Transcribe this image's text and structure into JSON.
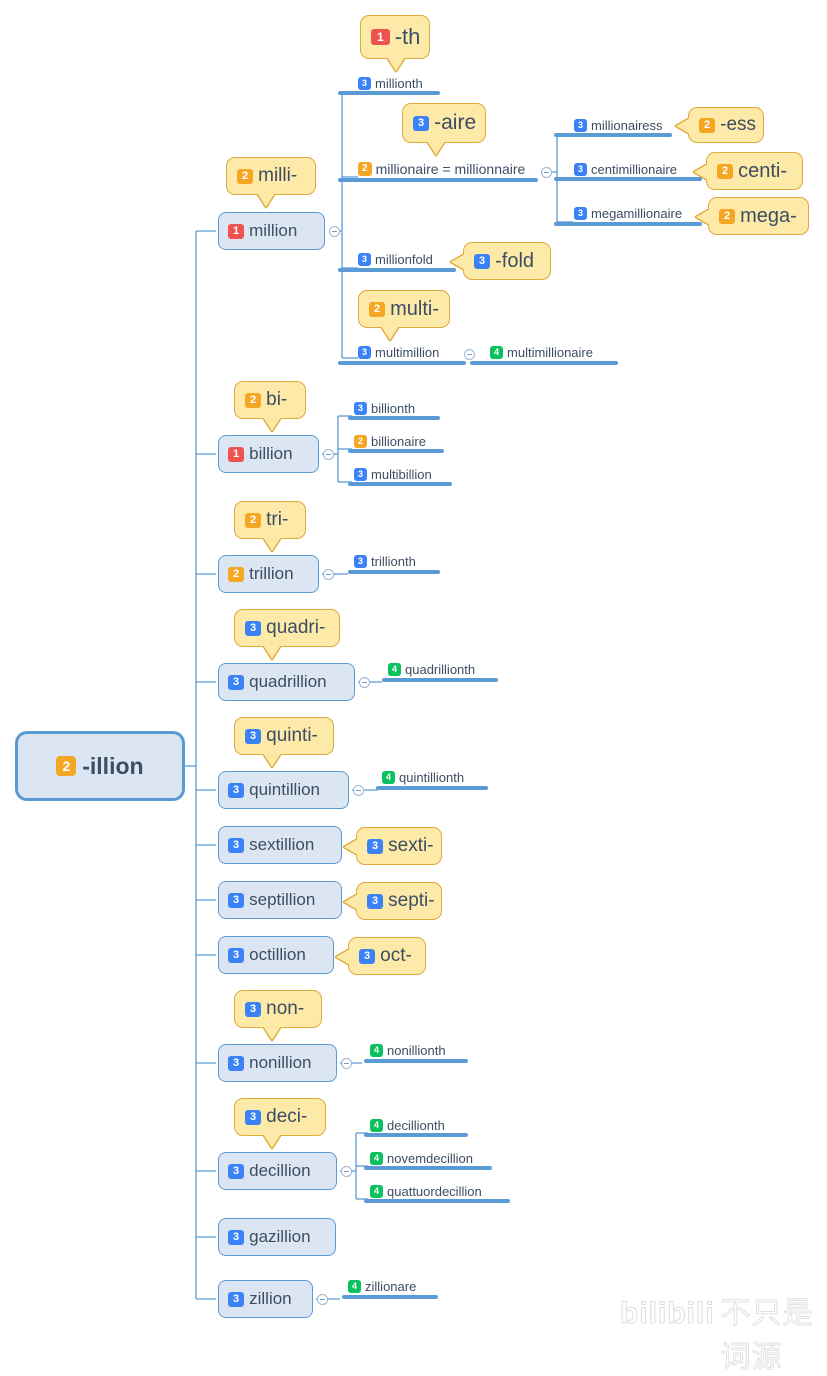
{
  "root": {
    "badge": "2",
    "level": 2,
    "label": "-illion"
  },
  "branches": [
    {
      "id": "million",
      "badge": "1",
      "level": 1,
      "label": "million",
      "prefix_callout": {
        "badge": "2",
        "level": 2,
        "label": "milli-"
      },
      "children": [
        {
          "badge": "3",
          "level": 3,
          "label": "millionth",
          "callout": {
            "badge": "1",
            "level": 1,
            "label": "-th",
            "dir": "down"
          }
        },
        {
          "badge": "2",
          "level": 2,
          "label": "millionaire = millionnaire",
          "callout": {
            "badge": "3",
            "level": 3,
            "label": "-aire",
            "dir": "down"
          },
          "children": [
            {
              "badge": "3",
              "level": 3,
              "label": "millionairess",
              "callout": {
                "badge": "2",
                "level": 2,
                "label": "-ess",
                "dir": "left"
              }
            },
            {
              "badge": "3",
              "level": 3,
              "label": "centimillionaire",
              "callout": {
                "badge": "2",
                "level": 2,
                "label": "centi-",
                "dir": "left"
              }
            },
            {
              "badge": "3",
              "level": 3,
              "label": "megamillionaire",
              "callout": {
                "badge": "2",
                "level": 2,
                "label": "mega-",
                "dir": "left"
              }
            }
          ]
        },
        {
          "badge": "3",
          "level": 3,
          "label": "millionfold",
          "callout": {
            "badge": "3",
            "level": 3,
            "label": "-fold",
            "dir": "left"
          }
        },
        {
          "badge": "3",
          "level": 3,
          "label": "multimillion",
          "callout": {
            "badge": "2",
            "level": 2,
            "label": "multi-",
            "dir": "down"
          },
          "children": [
            {
              "badge": "4",
              "level": 4,
              "label": "multimillionaire"
            }
          ]
        }
      ]
    },
    {
      "id": "billion",
      "badge": "1",
      "level": 1,
      "label": "billion",
      "prefix_callout": {
        "badge": "2",
        "level": 2,
        "label": "bi-"
      },
      "children": [
        {
          "badge": "3",
          "level": 3,
          "label": "billionth"
        },
        {
          "badge": "2",
          "level": 2,
          "label": "billionaire"
        },
        {
          "badge": "3",
          "level": 3,
          "label": "multibillion"
        }
      ]
    },
    {
      "id": "trillion",
      "badge": "2",
      "level": 2,
      "label": "trillion",
      "prefix_callout": {
        "badge": "2",
        "level": 2,
        "label": "tri-"
      },
      "children": [
        {
          "badge": "3",
          "level": 3,
          "label": "trillionth"
        }
      ]
    },
    {
      "id": "quadrillion",
      "badge": "3",
      "level": 3,
      "label": "quadrillion",
      "prefix_callout": {
        "badge": "3",
        "level": 3,
        "label": "quadri-"
      },
      "children": [
        {
          "badge": "4",
          "level": 4,
          "label": "quadrillionth"
        }
      ]
    },
    {
      "id": "quintillion",
      "badge": "3",
      "level": 3,
      "label": "quintillion",
      "prefix_callout": {
        "badge": "3",
        "level": 3,
        "label": "quinti-"
      },
      "children": [
        {
          "badge": "4",
          "level": 4,
          "label": "quintillionth"
        }
      ]
    },
    {
      "id": "sextillion",
      "badge": "3",
      "level": 3,
      "label": "sextillion",
      "side_callout": {
        "badge": "3",
        "level": 3,
        "label": "sexti-"
      },
      "children": []
    },
    {
      "id": "septillion",
      "badge": "3",
      "level": 3,
      "label": "septillion",
      "side_callout": {
        "badge": "3",
        "level": 3,
        "label": "septi-"
      },
      "children": []
    },
    {
      "id": "octillion",
      "badge": "3",
      "level": 3,
      "label": "octillion",
      "side_callout": {
        "badge": "3",
        "level": 3,
        "label": "oct-"
      },
      "children": []
    },
    {
      "id": "nonillion",
      "badge": "3",
      "level": 3,
      "label": "nonillion",
      "prefix_callout": {
        "badge": "3",
        "level": 3,
        "label": "non-"
      },
      "children": [
        {
          "badge": "4",
          "level": 4,
          "label": "nonillionth"
        }
      ]
    },
    {
      "id": "decillion",
      "badge": "3",
      "level": 3,
      "label": "decillion",
      "prefix_callout": {
        "badge": "3",
        "level": 3,
        "label": "deci-"
      },
      "children": [
        {
          "badge": "4",
          "level": 4,
          "label": "decillionth"
        },
        {
          "badge": "4",
          "level": 4,
          "label": "novemdecillion"
        },
        {
          "badge": "4",
          "level": 4,
          "label": "quattuordecillion"
        }
      ]
    },
    {
      "id": "gazillion",
      "badge": "3",
      "level": 3,
      "label": "gazillion",
      "children": []
    },
    {
      "id": "zillion",
      "badge": "3",
      "level": 3,
      "label": "zillion",
      "children": [
        {
          "badge": "4",
          "level": 4,
          "label": "zillionare"
        }
      ]
    }
  ],
  "watermark": {
    "brand": "bilibili",
    "text": "不只是词源"
  },
  "colors": {
    "level1": "#ef5350",
    "level2": "#f5a623",
    "level3": "#3b82f6",
    "level4": "#09c25f",
    "node_fill": "#dce6f2",
    "node_border": "#5b9bd5",
    "callout_fill": "#fdeaa8",
    "callout_border": "#e0a93b",
    "text": "#3d4d63"
  }
}
